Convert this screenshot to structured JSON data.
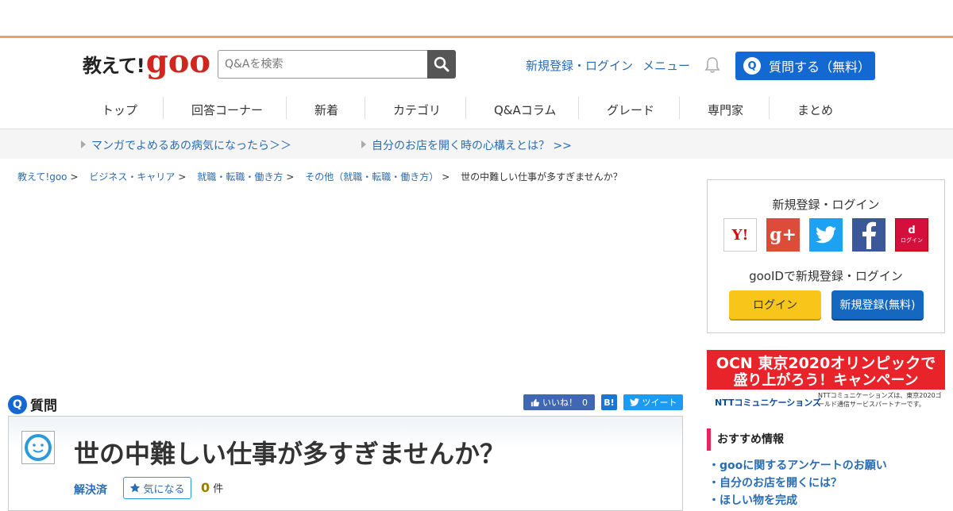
{
  "header": {
    "logo_text": "教えて!",
    "logo_brand": "goo",
    "search_placeholder": "Q&Aを検索",
    "register_login": "新規登録・ログイン",
    "menu": "メニュー",
    "ask_button": "質問する（無料）",
    "ask_icon": "Q"
  },
  "nav": {
    "items": [
      "トップ",
      "回答コーナー",
      "新着",
      "カテゴリ",
      "Q&Aコラム",
      "グレード",
      "専門家",
      "まとめ"
    ]
  },
  "promo": {
    "links": [
      "マンガでよめるあの病気になったら＞＞",
      "自分のお店を開く時の心構えとは？ >>"
    ]
  },
  "breadcrumb": {
    "items": [
      "教えて!goo",
      "ビジネス・キャリア",
      "就職・転職・働き方",
      "その他（就職・転職・働き方）"
    ],
    "current": "世の中難しい仕事が多すぎませんか？"
  },
  "question": {
    "section_label": "質問",
    "section_icon": "Q",
    "title": "世の中難しい仕事が多すぎませんか？",
    "status": "解決済",
    "bookmark_label": "気になる",
    "count": "0",
    "count_unit": "件",
    "like_label": "いいね！",
    "like_count": "0",
    "hatena_label": "B!",
    "tweet_label": "ツイート"
  },
  "sidebar": {
    "login_title": "新規登録・ログイン",
    "social": [
      "Y!",
      "g+",
      "twitter",
      "f",
      "d"
    ],
    "docomo_label": "ログイン",
    "gooid_text": "gooIDで新規登録・ログイン",
    "login_button": "ログイン",
    "register_button": "新規登録(無料)",
    "banner_line1": "OCN 東京2020オリンピックで",
    "banner_line2": "盛り上がろう！キャンペーン",
    "banner_company": "NTTコミュニケーションズ",
    "banner_note": "NTTコミュニケーションズは、東京2020ゴールド通信サービスパートナーです。",
    "reco_title": "おすすめ情報",
    "reco_items": [
      "・gooに関するアンケートのお願い",
      "・自分のお店を開くには？",
      "・ほしい物を完成"
    ]
  },
  "colors": {
    "brand_red": "#d0261e",
    "link_blue": "#2a6cb3",
    "button_blue": "#1468d2",
    "login_yellow": "#f8c51b"
  }
}
